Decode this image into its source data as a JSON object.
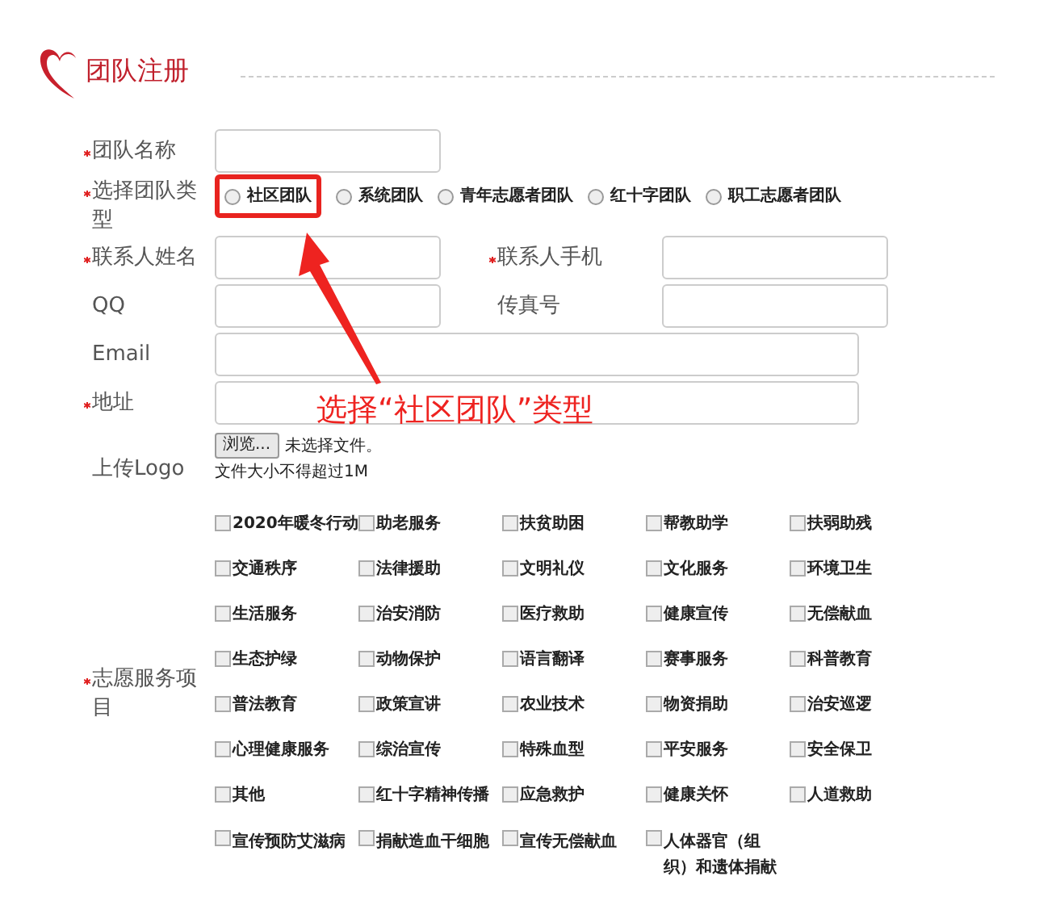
{
  "header": {
    "title": "团队注册"
  },
  "fields": [
    {
      "kind": "text",
      "label": "团队名称",
      "required": true
    },
    {
      "kind": "radio",
      "label": "选择团队类型",
      "required": true,
      "options": [
        {
          "label": "社区团队",
          "selected": false
        },
        {
          "label": "系统团队",
          "selected": false
        },
        {
          "label": "青年志愿者团队",
          "selected": false
        },
        {
          "label": "红十字团队",
          "selected": false
        },
        {
          "label": "职工志愿者团队",
          "selected": false
        }
      ]
    },
    {
      "kind": "pair",
      "label": "联系人姓名",
      "required": true,
      "label_2": "联系人手机",
      "required_2": true
    },
    {
      "kind": "pair",
      "label": "QQ",
      "required": false,
      "label_2": "传真号",
      "required_2": false
    },
    {
      "kind": "wide",
      "label": "Email",
      "required": false
    },
    {
      "kind": "wide",
      "label": "地址",
      "required": true
    },
    {
      "kind": "file",
      "label": "上传Logo",
      "required": false,
      "button": "浏览...",
      "status": "未选择文件。",
      "hint": "文件大小不得超过1M"
    },
    {
      "kind": "checks",
      "label": "志愿服务项目",
      "required": true,
      "options": [
        {
          "label": "2020年暖冬行动",
          "checked": false
        },
        {
          "label": "助老服务",
          "checked": false
        },
        {
          "label": "扶贫助困",
          "checked": false
        },
        {
          "label": "帮教助学",
          "checked": false
        },
        {
          "label": "扶弱助残",
          "checked": false
        },
        {
          "label": "交通秩序",
          "checked": false
        },
        {
          "label": "法律援助",
          "checked": false
        },
        {
          "label": "文明礼仪",
          "checked": false
        },
        {
          "label": "文化服务",
          "checked": false
        },
        {
          "label": "环境卫生",
          "checked": false
        },
        {
          "label": "生活服务",
          "checked": false
        },
        {
          "label": "治安消防",
          "checked": false
        },
        {
          "label": "医疗救助",
          "checked": false
        },
        {
          "label": "健康宣传",
          "checked": false
        },
        {
          "label": "无偿献血",
          "checked": false
        },
        {
          "label": "生态护绿",
          "checked": false
        },
        {
          "label": "动物保护",
          "checked": false
        },
        {
          "label": "语言翻译",
          "checked": false
        },
        {
          "label": "赛事服务",
          "checked": false
        },
        {
          "label": "科普教育",
          "checked": false
        },
        {
          "label": "普法教育",
          "checked": false
        },
        {
          "label": "政策宣讲",
          "checked": false
        },
        {
          "label": "农业技术",
          "checked": false
        },
        {
          "label": "物资捐助",
          "checked": false
        },
        {
          "label": "治安巡逻",
          "checked": false
        },
        {
          "label": "心理健康服务",
          "checked": false
        },
        {
          "label": "综治宣传",
          "checked": false
        },
        {
          "label": "特殊血型",
          "checked": false
        },
        {
          "label": "平安服务",
          "checked": false
        },
        {
          "label": "安全保卫",
          "checked": false
        },
        {
          "label": "其他",
          "checked": false
        },
        {
          "label": "红十字精神传播",
          "checked": false
        },
        {
          "label": "应急救护",
          "checked": false
        },
        {
          "label": "健康关怀",
          "checked": false
        },
        {
          "label": "人道救助",
          "checked": false
        },
        {
          "label": "宣传预防艾滋病",
          "checked": false
        },
        {
          "label": "捐献造血干细胞",
          "checked": false
        },
        {
          "label": "宣传无偿献血",
          "checked": false
        },
        {
          "label": "人体器官（组织）和遗体捐献",
          "checked": false
        }
      ]
    }
  ],
  "annotation": {
    "text": "选择“社区团队”类型"
  }
}
